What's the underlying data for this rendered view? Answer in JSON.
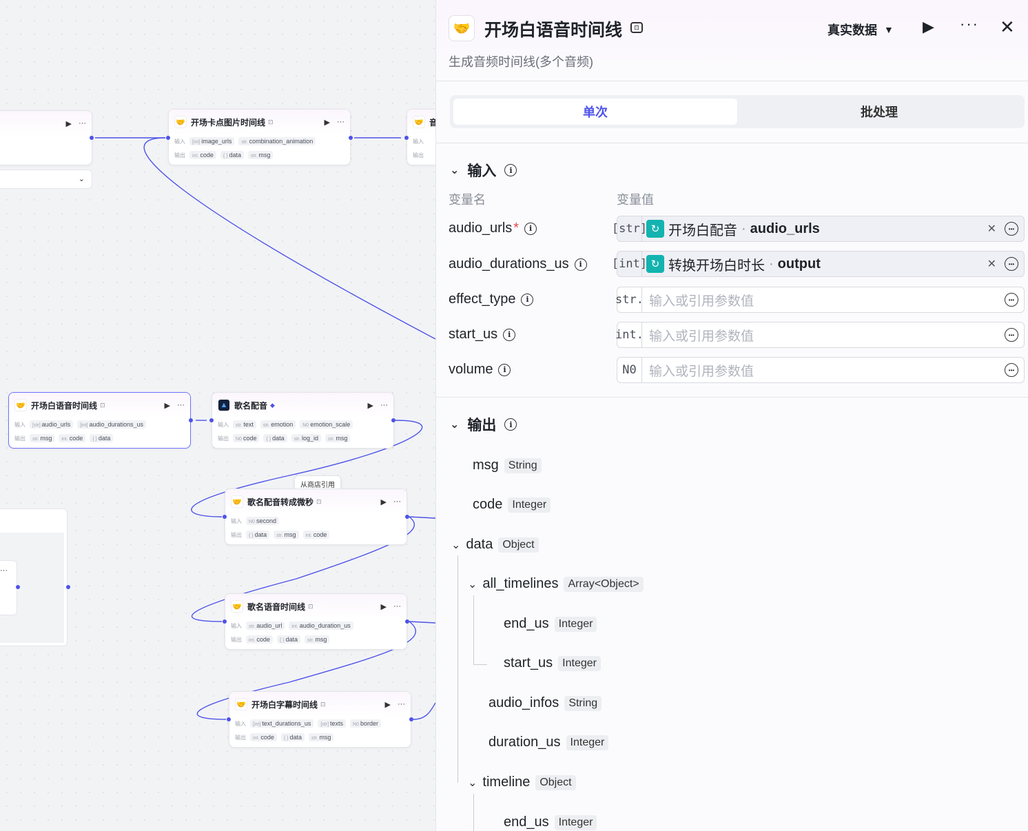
{
  "canvas": {
    "nodes": [
      {
        "id": "n-top-partial",
        "title": "",
        "in_label": "",
        "in_chips": [],
        "out_label": "",
        "out_chips": []
      },
      {
        "id": "n-card",
        "title": "开场卡点图片时间线",
        "in_label": "输入",
        "in_chips": [
          {
            "t": "[int]",
            "v": "image_urls"
          },
          {
            "t": "str.",
            "v": "combination_animation"
          }
        ],
        "out_label": "输出",
        "out_chips": [
          {
            "t": "int.",
            "v": "code"
          },
          {
            "t": "{ }",
            "v": "data"
          },
          {
            "t": "str.",
            "v": "msg"
          }
        ]
      },
      {
        "id": "n-right-partial",
        "title": "音",
        "in_label": "输入",
        "out_label": "输出"
      },
      {
        "id": "n-opening-audio",
        "title": "开场白语音时间线",
        "in_label": "输入",
        "in_chips": [
          {
            "t": "[str]",
            "v": "audio_urls"
          },
          {
            "t": "[int]",
            "v": "audio_durations_us"
          }
        ],
        "out_label": "输出",
        "out_chips": [
          {
            "t": "str.",
            "v": "msg"
          },
          {
            "t": "int.",
            "v": "code"
          },
          {
            "t": "{ }",
            "v": "data"
          }
        ]
      },
      {
        "id": "n-song-dub",
        "title": "歌名配音",
        "in_label": "输入",
        "in_chips": [
          {
            "t": "str.",
            "v": "text"
          },
          {
            "t": "str.",
            "v": "emotion"
          },
          {
            "t": "N0",
            "v": "emotion_scale"
          }
        ],
        "out_label": "输出",
        "out_chips": [
          {
            "t": "N0",
            "v": "code"
          },
          {
            "t": "{ }",
            "v": "data"
          },
          {
            "t": "str.",
            "v": "log_id"
          },
          {
            "t": "str.",
            "v": "msg"
          }
        ]
      },
      {
        "id": "n-song-convert",
        "title": "歌名配音转成微秒",
        "in_label": "输入",
        "in_chips": [
          {
            "t": "N0",
            "v": "second"
          }
        ],
        "out_label": "输出",
        "out_chips": [
          {
            "t": "{ }",
            "v": "data"
          },
          {
            "t": "str.",
            "v": "msg"
          },
          {
            "t": "int.",
            "v": "code"
          }
        ]
      },
      {
        "id": "n-song-timeline",
        "title": "歌名语音时间线",
        "in_label": "输入",
        "in_chips": [
          {
            "t": "str.",
            "v": "audio_url"
          },
          {
            "t": "int.",
            "v": "audio_duration_us"
          }
        ],
        "out_label": "输出",
        "out_chips": [
          {
            "t": "int.",
            "v": "code"
          },
          {
            "t": "{ }",
            "v": "data"
          },
          {
            "t": "str.",
            "v": "msg"
          }
        ]
      },
      {
        "id": "n-subtitle",
        "title": "开场白字幕时间线",
        "in_label": "输入",
        "in_chips": [
          {
            "t": "[int]",
            "v": "text_durations_us"
          },
          {
            "t": "[str]",
            "v": "texts"
          },
          {
            "t": "N0",
            "v": "border"
          }
        ],
        "out_label": "输出",
        "out_chips": [
          {
            "t": "int.",
            "v": "code"
          },
          {
            "t": "{ }",
            "v": "data"
          },
          {
            "t": "str.",
            "v": "msg"
          }
        ]
      }
    ],
    "store_tooltip": "从商店引用",
    "node_actions": {
      "run": "▶",
      "more": "···"
    }
  },
  "panel": {
    "title": "开场白语音时间线",
    "description": "生成音频时间线(多个音频)",
    "mode_label": "真实数据",
    "run_icon": "▶",
    "more_icon": "···",
    "close_icon": "✕",
    "tabs": [
      {
        "label": "单次",
        "active": true
      },
      {
        "label": "批处理",
        "active": false
      }
    ],
    "input_section": {
      "title": "输入",
      "col_name": "变量名",
      "col_value": "变量值",
      "params": [
        {
          "name": "audio_urls",
          "required": true,
          "type": "[str]",
          "ref_node": "开场白配音",
          "ref_output": "audio_urls",
          "placeholder": ""
        },
        {
          "name": "audio_durations_us",
          "required": false,
          "type": "[int]",
          "ref_node": "转换开场白时长",
          "ref_output": "output",
          "placeholder": ""
        },
        {
          "name": "effect_type",
          "required": false,
          "type": "str.",
          "ref_node": "",
          "ref_output": "",
          "placeholder": "输入或引用参数值"
        },
        {
          "name": "start_us",
          "required": false,
          "type": "int.",
          "ref_node": "",
          "ref_output": "",
          "placeholder": "输入或引用参数值"
        },
        {
          "name": "volume",
          "required": false,
          "type": "N0",
          "ref_node": "",
          "ref_output": "",
          "placeholder": "输入或引用参数值"
        }
      ]
    },
    "output_section": {
      "title": "输出",
      "items": [
        {
          "name": "msg",
          "type": "String"
        },
        {
          "name": "code",
          "type": "Integer"
        },
        {
          "name": "data",
          "type": "Object"
        },
        {
          "name": "all_timelines",
          "type": "Array<Object>"
        },
        {
          "name": "end_us",
          "type": "Integer"
        },
        {
          "name": "start_us",
          "type": "Integer"
        },
        {
          "name": "audio_infos",
          "type": "String"
        },
        {
          "name": "duration_us",
          "type": "Integer"
        },
        {
          "name": "timeline",
          "type": "Object"
        },
        {
          "name": "end_us",
          "type": "Integer"
        }
      ]
    },
    "colors": {
      "accent": "#4d53e8",
      "ref_icon": "#13b3b0",
      "required": "#e5484d"
    }
  }
}
